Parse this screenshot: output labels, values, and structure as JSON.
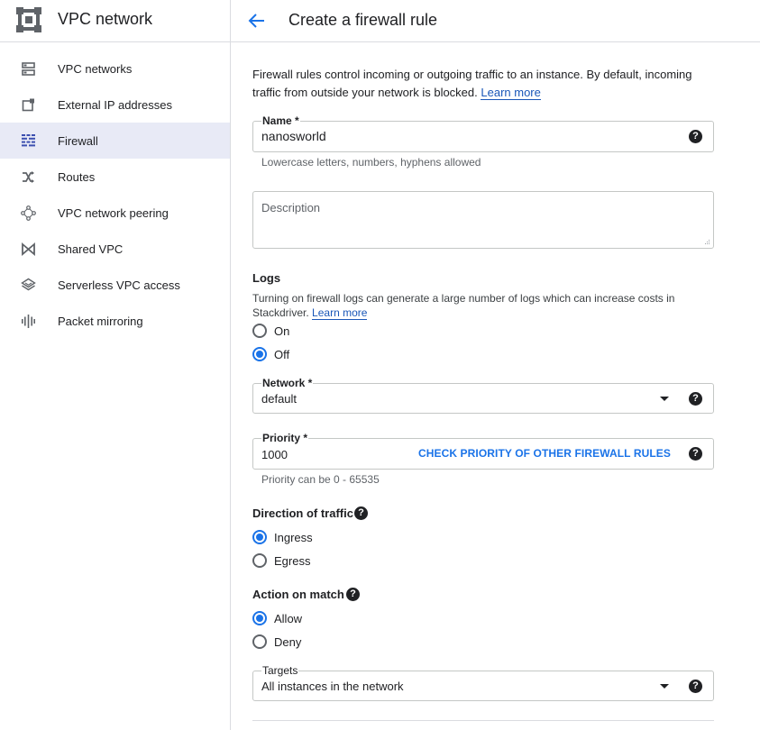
{
  "sidebar": {
    "product_title": "VPC network",
    "items": [
      {
        "label": "VPC networks",
        "icon": "vpc-networks-icon",
        "active": false
      },
      {
        "label": "External IP addresses",
        "icon": "external-ip-icon",
        "active": false
      },
      {
        "label": "Firewall",
        "icon": "firewall-icon",
        "active": true
      },
      {
        "label": "Routes",
        "icon": "routes-icon",
        "active": false
      },
      {
        "label": "VPC network peering",
        "icon": "peering-icon",
        "active": false
      },
      {
        "label": "Shared VPC",
        "icon": "shared-vpc-icon",
        "active": false
      },
      {
        "label": "Serverless VPC access",
        "icon": "serverless-icon",
        "active": false
      },
      {
        "label": "Packet mirroring",
        "icon": "packet-mirroring-icon",
        "active": false
      }
    ]
  },
  "header": {
    "title": "Create a firewall rule"
  },
  "form": {
    "intro_text": "Firewall rules control incoming or outgoing traffic to an instance. By default, incoming traffic from outside your network is blocked.",
    "intro_link": "Learn more",
    "name": {
      "label": "Name *",
      "value": "nanosworld",
      "hint": "Lowercase letters, numbers, hyphens allowed"
    },
    "description": {
      "placeholder": "Description",
      "value": ""
    },
    "logs": {
      "title": "Logs",
      "description": "Turning on firewall logs can generate a large number of logs which can increase costs in Stackdriver.",
      "link": "Learn more",
      "options": [
        {
          "label": "On",
          "checked": false
        },
        {
          "label": "Off",
          "checked": true
        }
      ]
    },
    "network": {
      "label": "Network *",
      "value": "default"
    },
    "priority": {
      "label": "Priority *",
      "value": "1000",
      "action": "CHECK PRIORITY OF OTHER FIREWALL RULES",
      "hint": "Priority can be 0 - 65535"
    },
    "direction": {
      "title": "Direction of traffic",
      "options": [
        {
          "label": "Ingress",
          "checked": true
        },
        {
          "label": "Egress",
          "checked": false
        }
      ]
    },
    "action": {
      "title": "Action on match",
      "options": [
        {
          "label": "Allow",
          "checked": true
        },
        {
          "label": "Deny",
          "checked": false
        }
      ]
    },
    "targets": {
      "label": "Targets",
      "value": "All instances in the network"
    }
  },
  "colors": {
    "accent": "#1a73e8",
    "active_nav_bg": "#e8eaf6",
    "border": "#dadce0"
  }
}
